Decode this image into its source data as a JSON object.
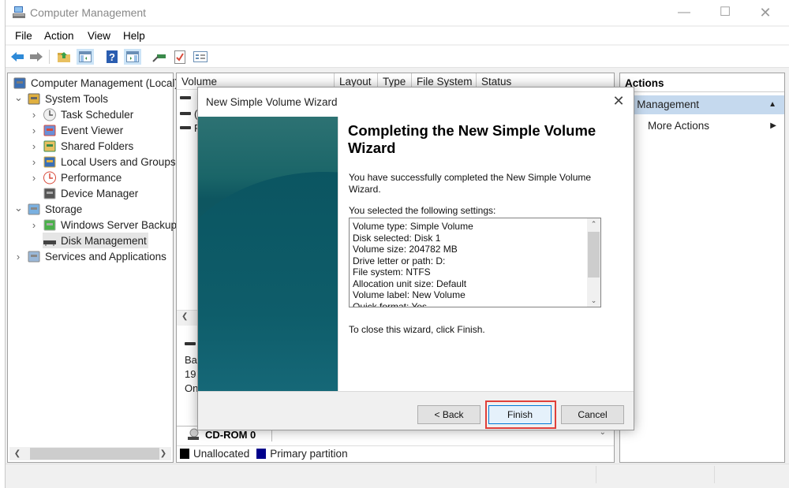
{
  "window": {
    "title": "Computer Management",
    "controls": {
      "minimize": "—",
      "maximize": "☐",
      "close": "✕"
    }
  },
  "menu": [
    "File",
    "Action",
    "View",
    "Help"
  ],
  "toolbar": {
    "buttons": [
      "back-icon",
      "forward-icon",
      "up-folder-icon",
      "show-hide-console-tree-icon",
      "help-icon",
      "show-hide-action-pane-icon",
      "connect-icon",
      "check-icon",
      "properties-icon"
    ]
  },
  "tree": {
    "items": [
      {
        "label": "Computer Management (Local)",
        "icon": "computer-management-icon",
        "level": 0,
        "expander": ""
      },
      {
        "label": "System Tools",
        "icon": "system-tools-icon",
        "level": 1,
        "expander": "⌄"
      },
      {
        "label": "Task Scheduler",
        "icon": "clock-icon",
        "level": 2,
        "expander": "›"
      },
      {
        "label": "Event Viewer",
        "icon": "event-viewer-icon",
        "level": 2,
        "expander": "›"
      },
      {
        "label": "Shared Folders",
        "icon": "shared-folders-icon",
        "level": 2,
        "expander": "›"
      },
      {
        "label": "Local Users and Groups",
        "icon": "users-icon",
        "level": 2,
        "expander": "›"
      },
      {
        "label": "Performance",
        "icon": "performance-icon",
        "level": 2,
        "expander": "›"
      },
      {
        "label": "Device Manager",
        "icon": "device-manager-icon",
        "level": 2,
        "expander": ""
      },
      {
        "label": "Storage",
        "icon": "storage-icon",
        "level": 1,
        "expander": "⌄"
      },
      {
        "label": "Windows Server Backup",
        "icon": "backup-icon",
        "level": 2,
        "expander": "›"
      },
      {
        "label": "Disk Management",
        "icon": "disk-management-icon",
        "level": 2,
        "expander": "",
        "selected": true
      },
      {
        "label": "Services and Applications",
        "icon": "services-icon",
        "level": 1,
        "expander": "›"
      }
    ]
  },
  "volume_list": {
    "columns": [
      "Volume",
      "Layout",
      "Type",
      "File System",
      "Status"
    ],
    "row_fragments": [
      "",
      "(",
      "F"
    ]
  },
  "disk_view": {
    "disk_fragments": [
      "Ba",
      "19",
      "On"
    ],
    "cdrom_label": "CD-ROM 0",
    "legend": [
      {
        "label": "Unallocated",
        "color": "#000000"
      },
      {
        "label": "Primary partition",
        "color": "#00008b"
      }
    ]
  },
  "actions": {
    "header": "Actions",
    "section_label": "sk Management",
    "items": [
      "More Actions"
    ]
  },
  "wizard": {
    "title": "New Simple Volume Wizard",
    "heading": "Completing the New Simple Volume Wizard",
    "success_text": "You have successfully completed the New Simple Volume Wizard.",
    "settings_intro": "You selected the following settings:",
    "settings": [
      "Volume type: Simple Volume",
      "Disk selected: Disk 1",
      "Volume size: 204782 MB",
      "Drive letter or path: D:",
      "File system: NTFS",
      "Allocation unit size: Default",
      "Volume label: New Volume",
      "Quick format: Yes"
    ],
    "close_hint": "To close this wizard, click Finish.",
    "buttons": {
      "back": "< Back",
      "finish": "Finish",
      "cancel": "Cancel"
    },
    "highlight_color": "#e0403a"
  }
}
